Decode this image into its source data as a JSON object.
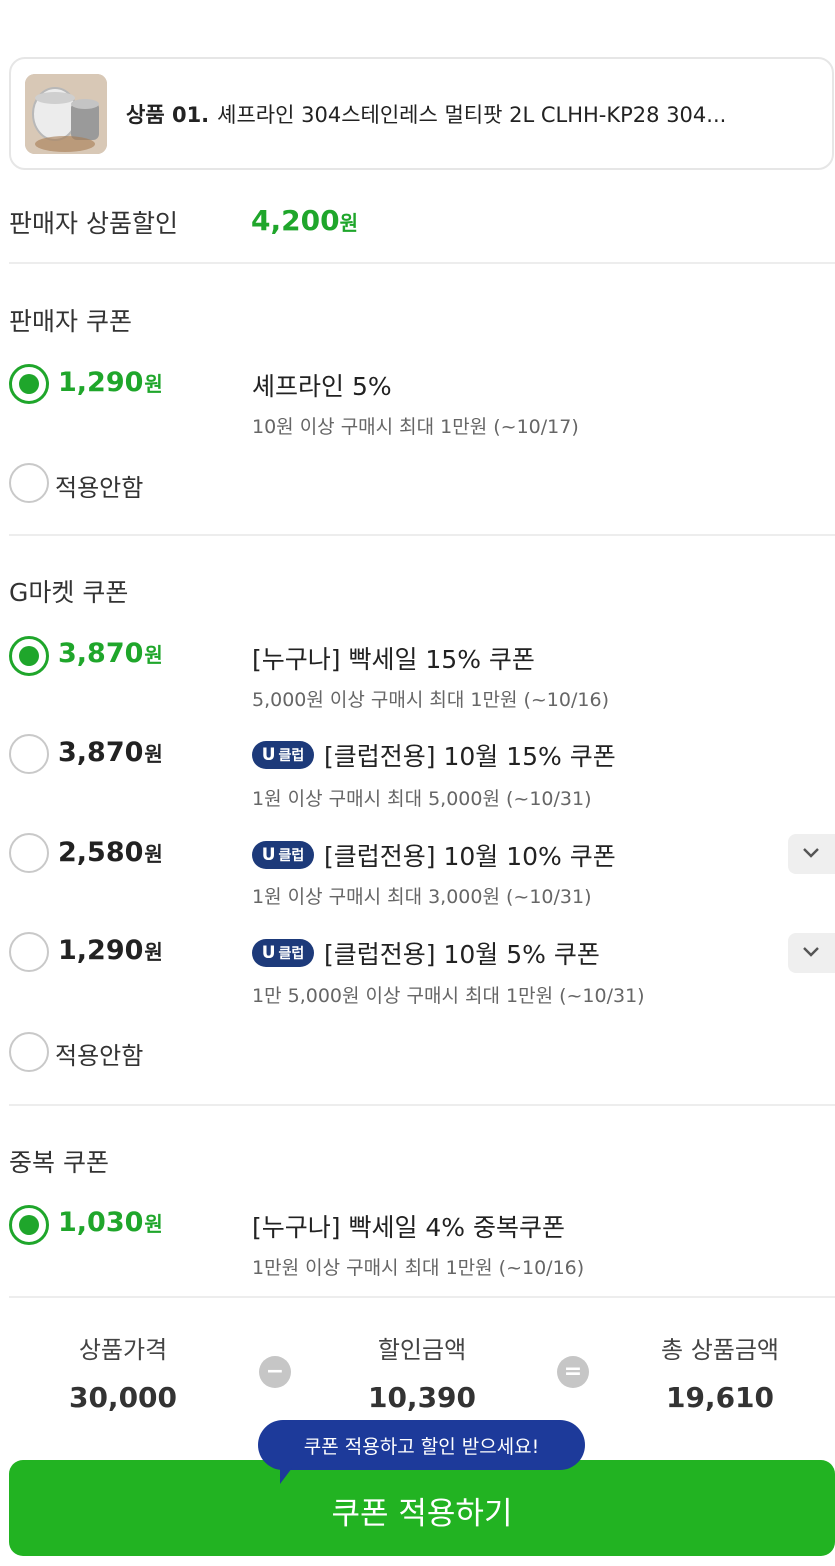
{
  "product": {
    "label": "상품 01.",
    "name": "셰프라인 304스테인레스 멀티팟 2L CLHH-KP28 304..."
  },
  "seller_discount": {
    "label": "판매자 상품할인",
    "amount": "4,200",
    "unit": "원"
  },
  "seller_coupon": {
    "title": "판매자 쿠폰",
    "options": [
      {
        "amount": "1,290",
        "unit": "원",
        "selected": true,
        "name": "셰프라인 5%",
        "condition": "10원 이상 구매시 최대 1만원 (~10/17)"
      }
    ],
    "none_label": "적용안함"
  },
  "gmarket_coupon": {
    "title": "G마켓 쿠폰",
    "options": [
      {
        "amount": "3,870",
        "unit": "원",
        "selected": true,
        "badge": "",
        "name": "[누구나] 빡세일 15% 쿠폰",
        "condition": "5,000원 이상 구매시 최대 1만원 (~10/16)"
      },
      {
        "amount": "3,870",
        "unit": "원",
        "selected": false,
        "badge_u": "U",
        "badge_text": "클럽",
        "name": "[클럽전용] 10월 15% 쿠폰",
        "condition": "1원 이상 구매시 최대 5,000원 (~10/31)"
      },
      {
        "amount": "2,580",
        "unit": "원",
        "selected": false,
        "badge_u": "U",
        "badge_text": "클럽",
        "name": "[클럽전용] 10월 10% 쿠폰",
        "condition": "1원 이상 구매시 최대 3,000원 (~10/31)"
      },
      {
        "amount": "1,290",
        "unit": "원",
        "selected": false,
        "badge_u": "U",
        "badge_text": "클럽",
        "name": "[클럽전용] 10월 5% 쿠폰",
        "condition": "1만 5,000원 이상 구매시 최대 1만원 (~10/31)"
      }
    ],
    "none_label": "적용안함"
  },
  "duplicate_coupon": {
    "title": "중복 쿠폰",
    "options": [
      {
        "amount": "1,030",
        "unit": "원",
        "selected": true,
        "name": "[누구나] 빡세일 4% 중복쿠폰",
        "condition": "1만원 이상 구매시 최대 1만원 (~10/16)"
      }
    ]
  },
  "summary": {
    "price_label": "상품가격",
    "price": "30,000",
    "discount_label": "할인금액",
    "discount": "10,390",
    "total_label": "총 상품금액",
    "total": "19,610",
    "minus_symbol": "−",
    "equals_symbol": "="
  },
  "tooltip": "쿠폰 적용하고 할인 받으세요!",
  "cta_label": "쿠폰 적용하기",
  "colors": {
    "accent_green": "#1fa62b",
    "cta_green": "#22b322",
    "club_badge": "#1d3a7a",
    "tooltip_blue": "#1d3a9a"
  }
}
